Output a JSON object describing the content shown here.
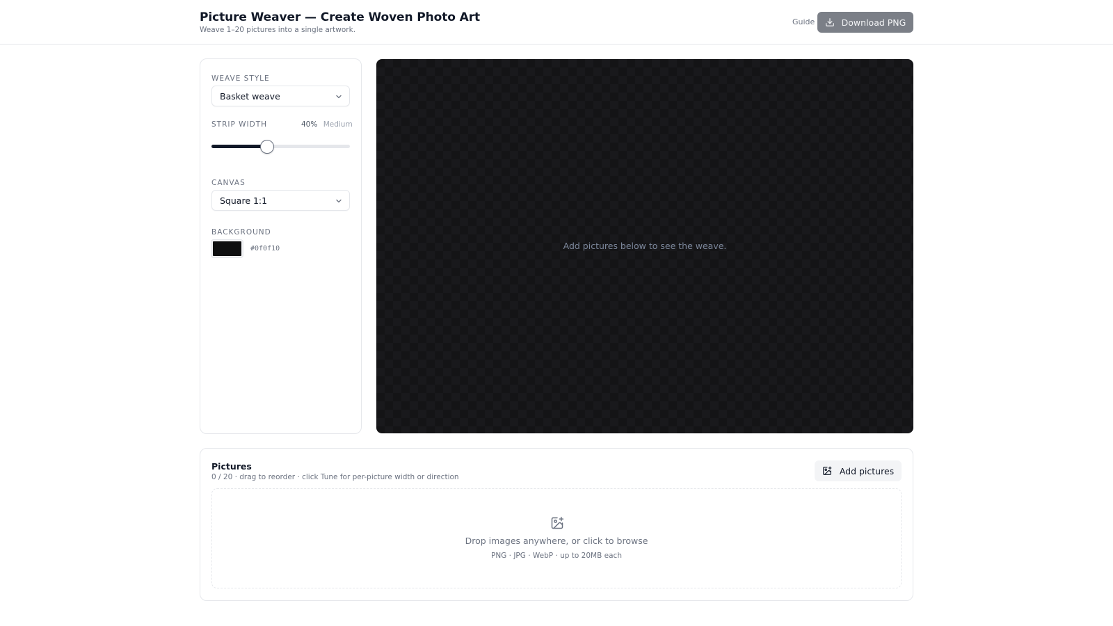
{
  "header": {
    "title": "Picture Weaver — Create Woven Photo Art",
    "subtitle": "Weave 1–20 pictures into a single artwork.",
    "guide_label": "Guide",
    "download_label": "Download PNG"
  },
  "settings": {
    "weave_style": {
      "label": "WEAVE STYLE",
      "value": "Basket weave"
    },
    "strip_width": {
      "label": "STRIP WIDTH",
      "percent_label": "40%",
      "descriptor": "Medium",
      "value": 0.4
    },
    "canvas": {
      "label": "CANVAS",
      "value": "Square 1:1"
    },
    "background": {
      "label": "BACKGROUND",
      "color": "#0f0f10",
      "hex_label": "#0f0f10"
    }
  },
  "preview": {
    "hint": "Add pictures below to see the weave.",
    "background_color": "#141416"
  },
  "pictures": {
    "title": "Pictures",
    "meta": "0 / 20 · drag to reorder · click Tune for per-picture width or direction",
    "add_label": "Add pictures",
    "dropzone_text": "Drop images anywhere, or click to browse",
    "dropzone_subtext": "PNG · JPG · WebP · up to 20MB each"
  },
  "icons": {
    "download": "download-icon",
    "chevron": "chevron-down-icon",
    "add_image": "image-plus-icon"
  },
  "colors": {
    "primary_button": "#7b7f87",
    "text": "#111827",
    "muted": "#6b7280",
    "border": "#e5e7eb"
  }
}
